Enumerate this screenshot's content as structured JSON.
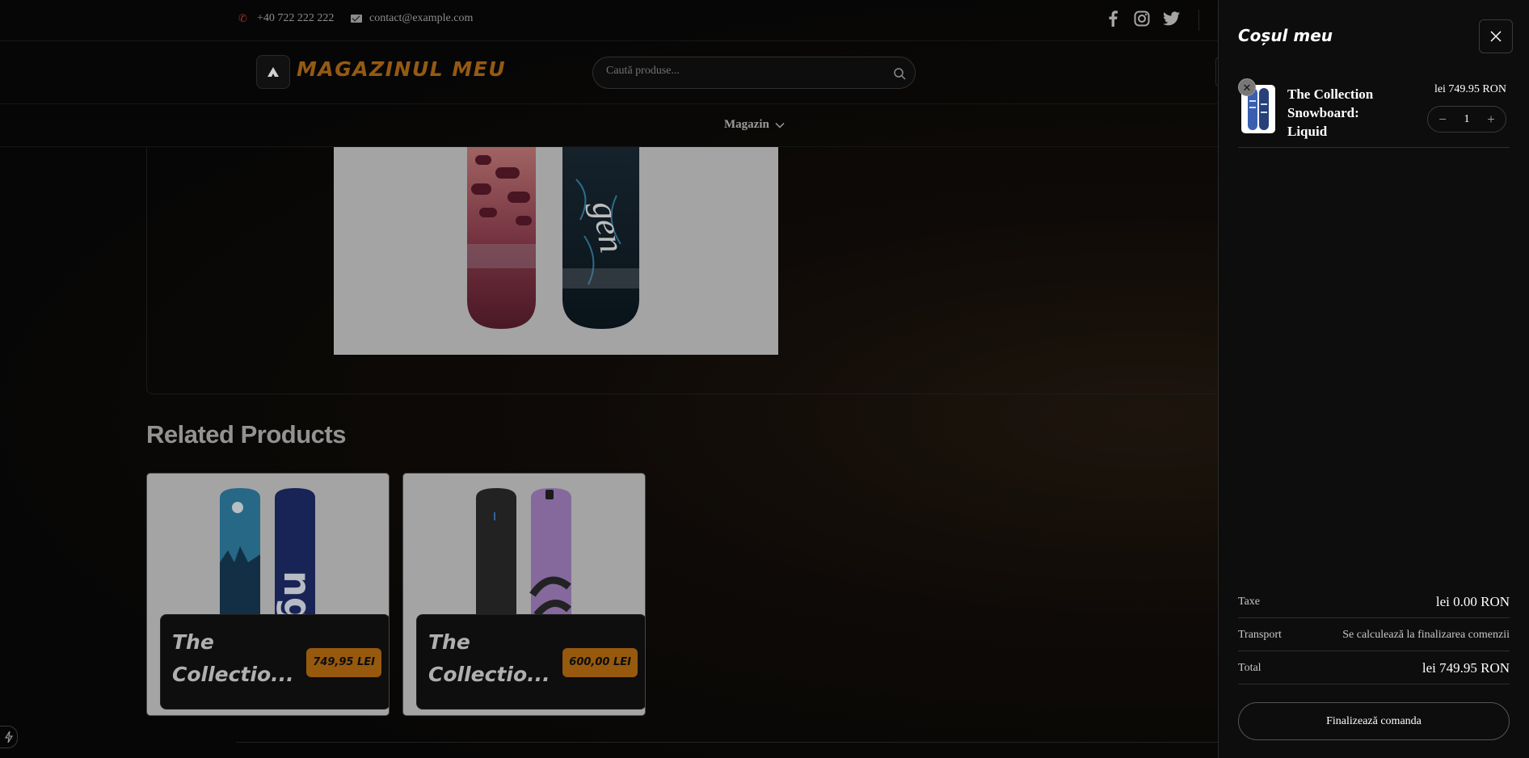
{
  "topbar": {
    "phone": "+40 722 222 222",
    "email": "contact@example.com",
    "social_icons": [
      "facebook-icon",
      "instagram-icon",
      "twitter-icon"
    ]
  },
  "header": {
    "logo_text": "MAGAZINUL MEU",
    "search_placeholder": "Caută produse..."
  },
  "nav": {
    "items": [
      {
        "label": "Magazin",
        "icon": "chevron-down-icon"
      }
    ]
  },
  "related": {
    "title": "Related Products",
    "products": [
      {
        "name": "The\nCollectio...",
        "price": "749,95 LEI"
      },
      {
        "name": "The\nCollectio...",
        "price": "600,00 LEI"
      }
    ]
  },
  "cart": {
    "title": "Coșul meu",
    "items": [
      {
        "name": "The Collection Snowboard: Liquid",
        "price": "lei 749.95 RON",
        "quantity": "1"
      }
    ],
    "summary": {
      "taxes_label": "Taxe",
      "taxes_value": "lei 0.00 RON",
      "shipping_label": "Transport",
      "shipping_value": "Se calculează la finalizarea comenzii",
      "total_label": "Total",
      "total_value": "lei 749.95 RON"
    },
    "checkout_label": "Finalizează comanda"
  },
  "colors": {
    "accent": "#b76d12",
    "background": "#0b0b0b",
    "drawer_bg": "#0d0d0d"
  }
}
